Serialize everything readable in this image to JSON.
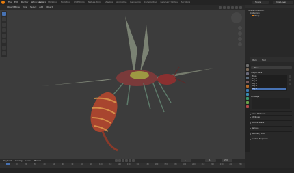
{
  "topbar": {
    "menu": [
      "File",
      "Edit",
      "Render",
      "Window",
      "Help"
    ],
    "tabs": [
      "Layout",
      "Modeling",
      "Sculpting",
      "UV Editing",
      "Texture Paint",
      "Shading",
      "Animation",
      "Rendering",
      "Compositing",
      "Geometry Nodes",
      "Scripting"
    ],
    "active_tab": "Layout",
    "scene": "Scene",
    "view_layer": "ViewLayer"
  },
  "viewport_header": {
    "items": [
      "Object Mode",
      "View",
      "Select",
      "Add",
      "Object"
    ]
  },
  "outliner": {
    "rows": [
      "Scene Collection",
      "Collection",
      "Wasp"
    ]
  },
  "properties": {
    "tabs": [
      "Item",
      "Tool"
    ],
    "object_name": "Wasp",
    "shape_keys_title": "Shape Keys",
    "shape_keys": [
      "Basis",
      "Key 1",
      "Key 2",
      "Key 3",
      "Key 4",
      "Key 5"
    ],
    "selected_index": 5,
    "uv_maps_title": "UV Maps",
    "sections": [
      "Color Attributes",
      "Attributes",
      "Texture Space",
      "Remesh",
      "Geometry Data",
      "Custom Properties"
    ]
  },
  "timeline": {
    "items": [
      "Playback",
      "Keying",
      "View",
      "Marker"
    ],
    "current_frame": "1",
    "start": "1",
    "end": "250",
    "ticks": [
      "0",
      "10",
      "20",
      "30",
      "40",
      "50",
      "60",
      "70",
      "80",
      "90",
      "100",
      "110",
      "120",
      "130",
      "140",
      "150",
      "160",
      "170",
      "180",
      "190",
      "200",
      "210",
      "220",
      "230",
      "240",
      "250"
    ]
  }
}
